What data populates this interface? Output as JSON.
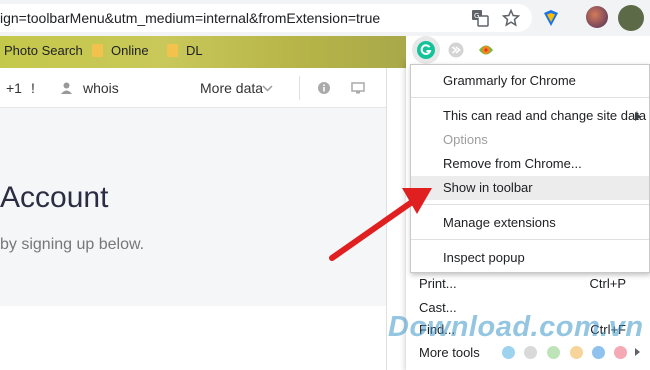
{
  "omnibox": {
    "url_text": "ign=toolbarMenu&utm_medium=internal&fromExtension=true"
  },
  "bookmarks": {
    "items": [
      {
        "label": "Photo Search"
      },
      {
        "label": "Online"
      },
      {
        "label": "DL"
      }
    ]
  },
  "page": {
    "toolbar": {
      "plus_one": "+1",
      "bang": "!",
      "whois": "whois",
      "more_data": "More data"
    },
    "headline": "Account",
    "subline": "by signing up below."
  },
  "context_menu": {
    "items": [
      {
        "label": "Grammarly for Chrome"
      },
      {
        "label": "This can read and change site data"
      },
      {
        "label": "Options"
      },
      {
        "label": "Remove from Chrome..."
      },
      {
        "label": "Show in toolbar"
      },
      {
        "label": "Manage extensions"
      },
      {
        "label": "Inspect popup"
      }
    ]
  },
  "chrome_menu": {
    "print": "Print...",
    "print_shortcut": "Ctrl+P",
    "cast": "Cast...",
    "find": "Find...",
    "find_shortcut": "Ctrl+F",
    "more_tools": "More tools"
  },
  "watermark": "Download.com.vn",
  "colors": {
    "grammarly_green": "#15c39a",
    "arrow_red": "#e02020",
    "bookmark_bar": "#c4c84a"
  }
}
